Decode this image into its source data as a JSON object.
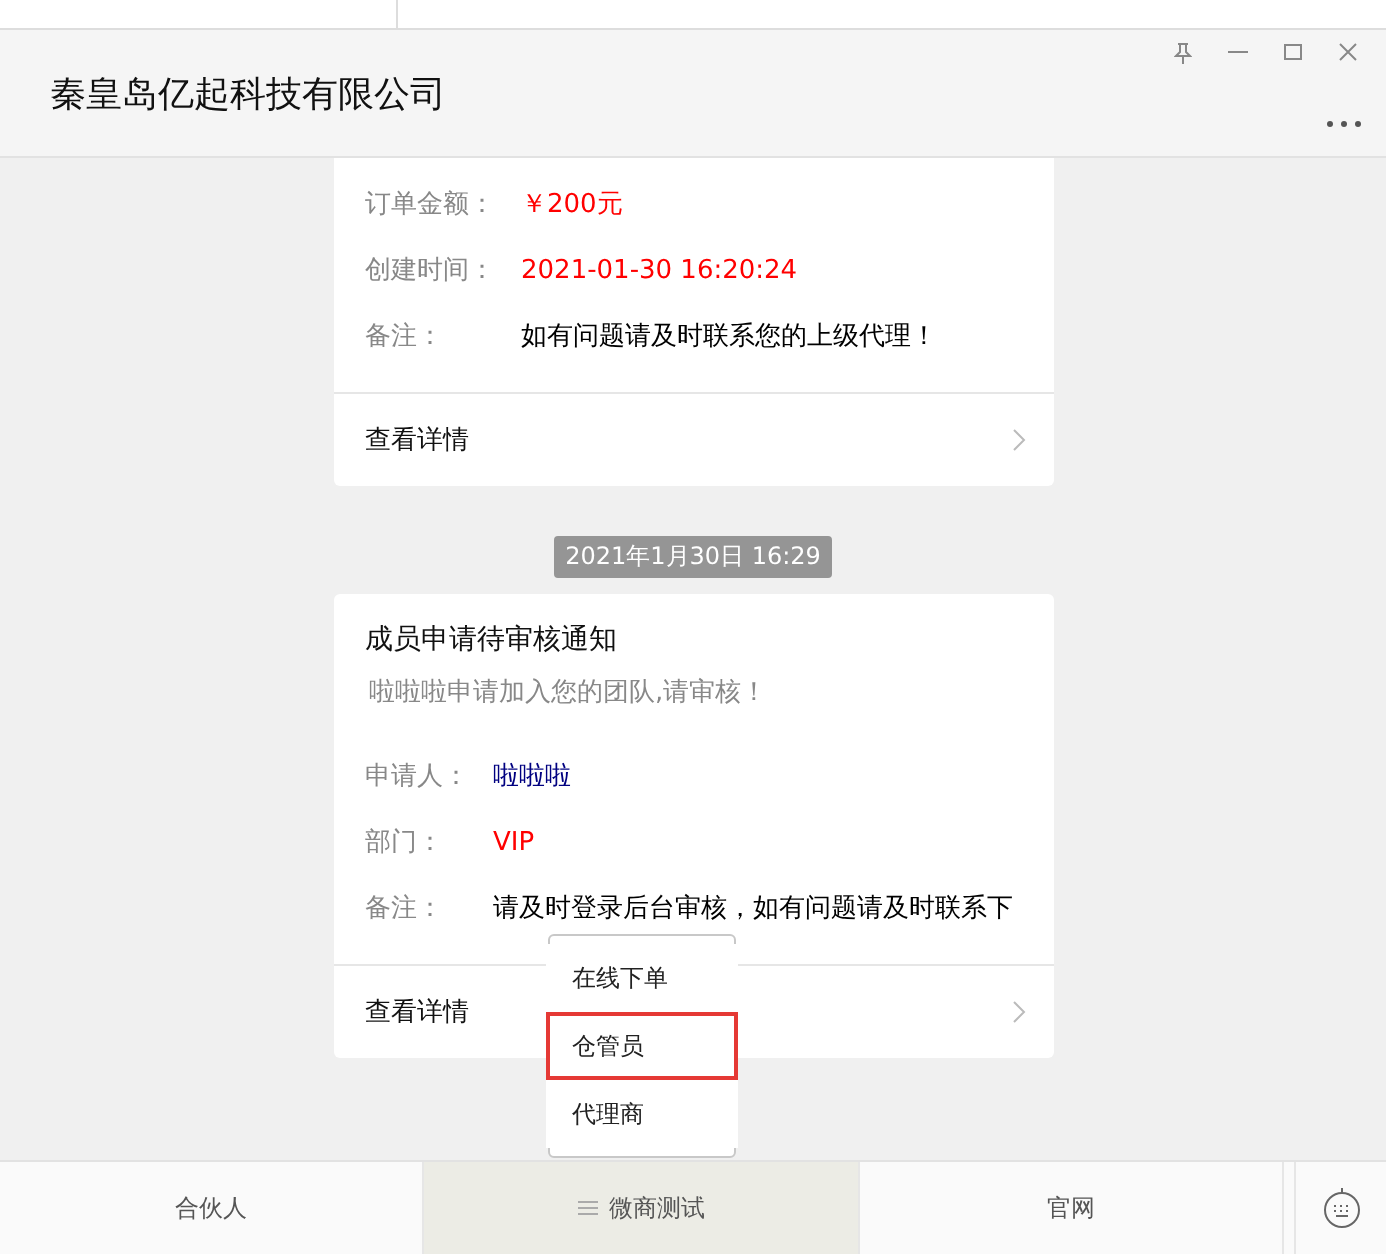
{
  "window": {
    "title": "秦皇岛亿起科技有限公司"
  },
  "feed": [
    {
      "kind": "card",
      "fields": [
        {
          "label": "订单金额：",
          "value": "￥200元",
          "color": "#ff0000"
        },
        {
          "label": "创建时间：",
          "value": "2021-01-30 16:20:24",
          "color": "#ff0000"
        },
        {
          "label": "备注：",
          "value": "如有问题请及时联系您的上级代理！",
          "color": "#000000"
        }
      ],
      "link": "查看详情"
    },
    {
      "kind": "time",
      "text": "2021年1月30日 16:29"
    },
    {
      "kind": "card",
      "title": "成员申请待审核通知",
      "subtitle": "啦啦啦申请加入您的团队,请审核！",
      "fields": [
        {
          "label": "申请人：",
          "value": "啦啦啦",
          "color": "#000080"
        },
        {
          "label": "部门：",
          "value": "VIP",
          "color": "#ff0000"
        },
        {
          "label": "备注：",
          "value": "请及时登录后台审核，如有问题请及时联系下",
          "color": "#000000"
        }
      ],
      "link": "查看详情"
    }
  ],
  "menu": [
    {
      "label": "合伙人",
      "expanded": false
    },
    {
      "label": "微商测试",
      "expanded": true,
      "submenu": [
        {
          "label": "在线下单",
          "selected": false
        },
        {
          "label": "仓管员",
          "selected": true
        },
        {
          "label": "代理商",
          "selected": false
        }
      ]
    },
    {
      "label": "官网",
      "expanded": false
    }
  ]
}
